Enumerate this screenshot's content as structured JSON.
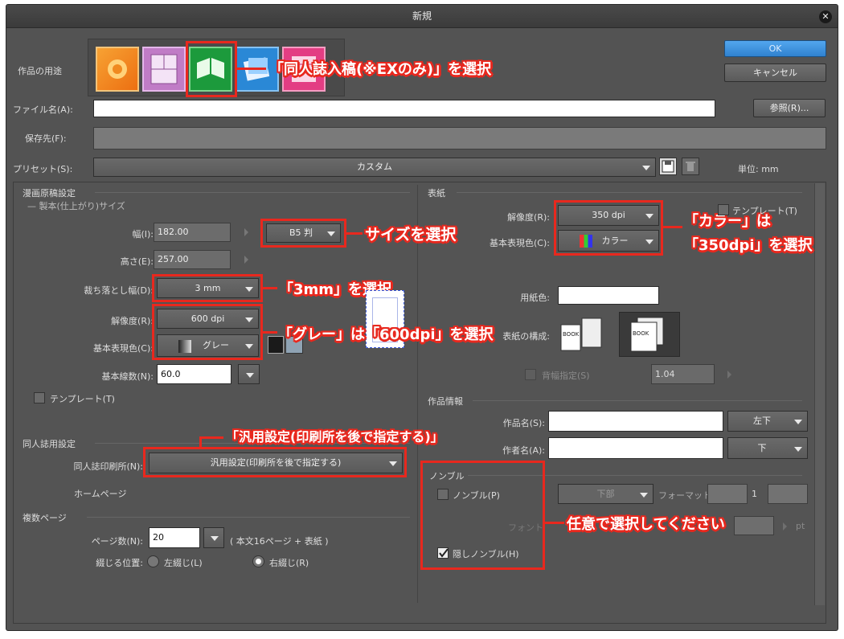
{
  "window": {
    "title": "新規"
  },
  "actions": {
    "ok": "OK",
    "cancel": "キャンセル",
    "browse": "参照(R)..."
  },
  "top": {
    "purpose_label": "作品の用途",
    "filename_label": "ファイル名(A):",
    "filename_value": "",
    "save_label": "保存先(F):",
    "save_value": "",
    "preset_label": "プリセット(S):",
    "preset_value": "カスタム",
    "unit_label": "単位:",
    "unit_value": "mm"
  },
  "manga": {
    "section": "漫画原稿設定",
    "subsection": "製本(仕上がり)サイズ",
    "width_label": "幅(I):",
    "width_value": "182.00",
    "size_preset": "B5 判",
    "height_label": "高さ(E):",
    "height_value": "257.00",
    "bleed_label": "裁ち落とし幅(D):",
    "bleed_value": "3 mm",
    "res_label": "解像度(R):",
    "res_value": "600 dpi",
    "color_label": "基本表現色(C):",
    "color_value": "グレー",
    "lpi_label": "基本線数(N):",
    "lpi_value": "60.0",
    "template_label": "テンプレート(T)"
  },
  "doujin": {
    "section": "同人誌用設定",
    "printer_label": "同人誌印刷所(N):",
    "printer_value": "汎用設定(印刷所を後で指定する)",
    "homepage_label": "ホームページ"
  },
  "pages": {
    "section": "複数ページ",
    "count_label": "ページ数(N):",
    "count_value": "20",
    "count_note": "( 本文16ページ + 表紙 )",
    "bind_label": "綴じる位置:",
    "left_bind": "左綴じ(L)",
    "right_bind": "右綴じ(R)"
  },
  "cover": {
    "section": "表紙",
    "res_label": "解像度(R):",
    "res_value": "350 dpi",
    "color_label": "基本表現色(C):",
    "color_value": "カラー",
    "template_label": "テンプレート(T)",
    "paper_label": "用紙色:",
    "structure_label": "表紙の構成:",
    "book_text": "BOOK",
    "spine_label": "背幅指定(S)",
    "spine_value": "1.04"
  },
  "work_info": {
    "section": "作品情報",
    "name_label": "作品名(S):",
    "name_pos": "左下",
    "author_label": "作者名(A):",
    "author_pos": "下"
  },
  "nombre": {
    "section": "ノンブル",
    "nombre_label": "ノンブル(P)",
    "position": "下部",
    "format_label": "フォーマット:",
    "format_value": "1",
    "font_label": "フォント",
    "pt_unit": "pt",
    "hidden_label": "隠しノンブル(H)"
  },
  "annotations": {
    "purpose": "「同人誌入稿(※EXのみ)」を選択",
    "size": "サイズを選択",
    "bleed": "「3mm」を選択",
    "res_color": "「グレー」は「600dpi」を選択",
    "cover_1": "「カラー」は",
    "cover_2": "「350dpi」を選択",
    "printer": "「汎用設定(印刷所を後で指定する)」",
    "nombre": "任意で選択してください"
  },
  "colors": {
    "accent": "#e8281e",
    "ok": "#3b8fdc",
    "dialog": "#535353"
  }
}
